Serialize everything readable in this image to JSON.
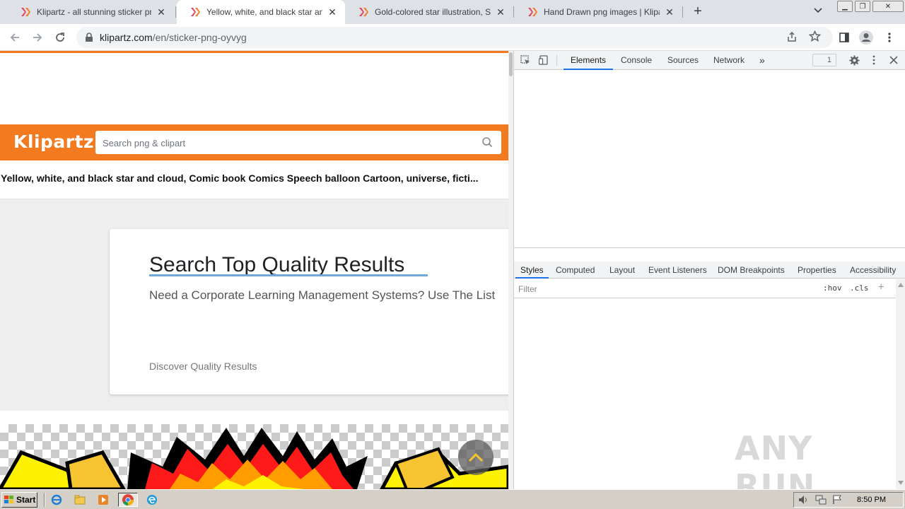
{
  "browser": {
    "tabs": [
      {
        "title": "Klipartz - all stunning sticker png ima",
        "active": false
      },
      {
        "title": "Yellow, white, and black star and clo",
        "active": true
      },
      {
        "title": "Gold-colored star illustration, Star De",
        "active": false
      },
      {
        "title": "Hand Drawn png images | Klipartz",
        "active": false
      }
    ],
    "new_tab_label": "+",
    "url_host": "klipartz.com",
    "url_path": "/en/sticker-png-oyvyg"
  },
  "page": {
    "logo_text": "Klipartz",
    "search_placeholder": "Search png & clipart",
    "title": "Yellow, white, and black star and cloud, Comic book Comics Speech balloon Cartoon, universe, ficti...",
    "ad": {
      "title": "Search Top Quality Results",
      "description": "Need a Corporate Learning Management Systems? Use The List",
      "link": "Discover Quality Results"
    }
  },
  "devtools": {
    "tabs": [
      "Elements",
      "Console",
      "Sources",
      "Network"
    ],
    "more_label": "»",
    "issues_count": "1",
    "sub_tabs": [
      "Styles",
      "Computed",
      "Layout",
      "Event Listeners",
      "DOM Breakpoints",
      "Properties",
      "Accessibility"
    ],
    "filter_placeholder": "Filter",
    "hov_label": ":hov",
    "cls_label": ".cls",
    "add_label": "+",
    "watermark": "ANY RUN"
  },
  "taskbar": {
    "start_label": "Start",
    "clock": "8:50 PM"
  },
  "colors": {
    "brand_orange": "#f47a20",
    "devtools_accent": "#1a73e8"
  }
}
